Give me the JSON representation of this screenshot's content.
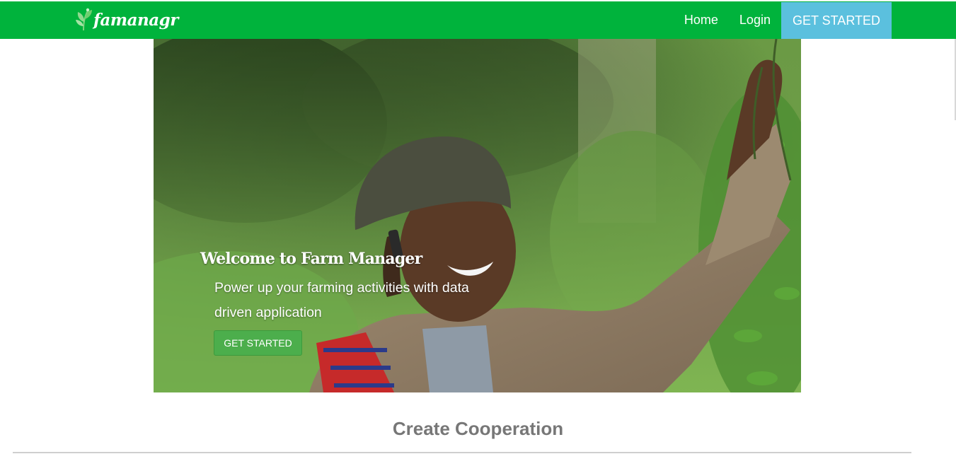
{
  "brand": {
    "name": "famanagr",
    "icon": "leaf-icon"
  },
  "nav": {
    "links": [
      "Home",
      "Login"
    ],
    "cta_label": "GET STARTED"
  },
  "hero": {
    "title": "Welcome to Farm Manager",
    "subtitle": "Power up your farming activities with data driven application",
    "button_label": "GET STARTED"
  },
  "section": {
    "title": "Create Cooperation"
  },
  "colors": {
    "navbar": "#00b33c",
    "nav_cta": "#5bc0de",
    "hero_button": "#4cae4c",
    "section_title": "#777777"
  }
}
